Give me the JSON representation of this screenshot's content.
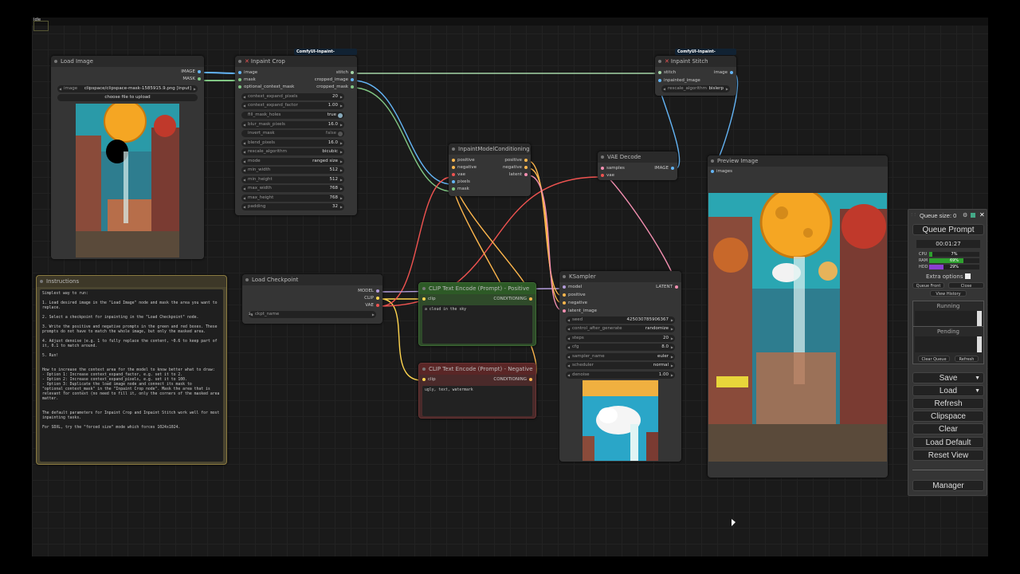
{
  "status": {
    "idle": "Idle"
  },
  "load_image": {
    "title": "Load Image",
    "outputs": [
      "IMAGE",
      "MASK"
    ],
    "image_label": "image",
    "image_value": "clipspace/clipspace-mask-1585915.9.png [input]",
    "upload_label": "choose file to upload"
  },
  "inpaint_crop": {
    "badge": "ComfyUI-Inpaint-CropAnd...",
    "title": "Inpaint Crop",
    "inputs": [
      "image",
      "mask",
      "optional_context_mask"
    ],
    "outputs": [
      "stitch",
      "cropped_image",
      "cropped_mask"
    ],
    "widgets": [
      {
        "label": "context_expand_pixels",
        "value": "20"
      },
      {
        "label": "context_expand_factor",
        "value": "1.00"
      },
      {
        "label": "fill_mask_holes",
        "value": "true"
      },
      {
        "label": "blur_mask_pixels",
        "value": "16.0"
      },
      {
        "label": "invert_mask",
        "value": "false"
      },
      {
        "label": "blend_pixels",
        "value": "16.0"
      },
      {
        "label": "rescale_algorithm",
        "value": "bicubic"
      },
      {
        "label": "mode",
        "value": "ranged size"
      },
      {
        "label": "min_width",
        "value": "512"
      },
      {
        "label": "min_height",
        "value": "512"
      },
      {
        "label": "max_width",
        "value": "768"
      },
      {
        "label": "max_height",
        "value": "768"
      },
      {
        "label": "padding",
        "value": "32"
      }
    ]
  },
  "inpaint_stitch": {
    "badge": "ComfyUI-Inpaint-CropAnd...",
    "title": "Inpaint Stitch",
    "inputs": [
      "stitch",
      "inpainted_image"
    ],
    "outputs": [
      "image"
    ],
    "widget_label": "rescale_algorithm",
    "widget_value": "bislerp"
  },
  "conditioning": {
    "title": "InpaintModelConditioning",
    "inputs": [
      "positive",
      "negative",
      "vae",
      "pixels",
      "mask"
    ],
    "outputs": [
      "positive",
      "negative",
      "latent"
    ]
  },
  "vae_decode": {
    "title": "VAE Decode",
    "inputs": [
      "samples",
      "vae"
    ],
    "outputs": [
      "IMAGE"
    ]
  },
  "preview": {
    "title": "Preview Image",
    "inputs": [
      "images"
    ]
  },
  "instructions": {
    "title": "Instructions",
    "text": "Simplest way to run:\n\n1. Load desired image in the \"Load Image\" node and mask the area you want to replace.\n\n2. Select a checkpoint for inpainting in the \"Load Checkpoint\" node.\n\n3. Write the positive and negative prompts in the green and red boxes. These prompts do not have to match the whole image, but only the masked area.\n\n4. Adjust denoise (e.g. 1 to fully replace the content, ~0.6 to keep part of it, 0.1 to match around.\n\n5. Run!\n\n\nHow to increase the context area for the model to know better what to draw:\n- Option 1: Increase context_expand_factor, e.g. set it to 2.\n- Option 2: Increase context_expand_pixels, e.g. set it to 100.\n- Option 3: Duplicate the load image node and connect its mask to \"optional_context_mask\" in the \"Inpaint Crop node\". Mask the area that is relevant for context (no need to fill it, only the corners of the masked area matter.\n\n\nThe default parameters for Inpaint Crop and Inpaint Stitch work well for most inpainting tasks.\n\nFor SDXL, try the \"forced size\" mode which forces 1024x1024."
  },
  "load_checkpoint": {
    "title": "Load Checkpoint",
    "outputs": [
      "MODEL",
      "CLIP",
      "VAE"
    ],
    "ckpt_label": "ckpt_name",
    "ckpt_value": "sd1.5-inpainting/realismixRealAmateur_v40Inpainting.safetensors"
  },
  "clip_positive": {
    "title": "CLIP Text Encode (Prompt) - Positive",
    "input": "clip",
    "output": "CONDITIONING",
    "text": "a cloud in the sky"
  },
  "clip_negative": {
    "title": "CLIP Text Encode (Prompt) - Negative",
    "input": "clip",
    "output": "CONDITIONING",
    "text": "ugly, text, watermark"
  },
  "ksampler": {
    "title": "KSampler",
    "inputs": [
      "model",
      "positive",
      "negative",
      "latent_image"
    ],
    "outputs": [
      "LATENT"
    ],
    "widgets": [
      {
        "label": "seed",
        "value": "425030785906367"
      },
      {
        "label": "control_after_generate",
        "value": "randomize"
      },
      {
        "label": "steps",
        "value": "20"
      },
      {
        "label": "cfg",
        "value": "8.0"
      },
      {
        "label": "sampler_name",
        "value": "euler"
      },
      {
        "label": "scheduler",
        "value": "normal"
      },
      {
        "label": "denoise",
        "value": "1.00"
      }
    ]
  },
  "queue": {
    "title": "Queue size: 0",
    "queue_prompt": "Queue Prompt",
    "timer": "00:01:27",
    "cpu_label": "CPU",
    "cpu": "7%",
    "cpu_frac": 0.07,
    "ram_label": "RAM",
    "ram": "69%",
    "ram_frac": 0.69,
    "hdd_label": "HDD",
    "hdd": "29%",
    "hdd_frac": 0.29,
    "extra_options": "Extra options",
    "queue_front": "Queue Front",
    "close": "Close",
    "view_history": "View History",
    "running": "Running",
    "pending": "Pending",
    "clear_queue": "Clear Queue",
    "refresh_small": "Refresh",
    "save": "Save",
    "load": "Load",
    "refresh": "Refresh",
    "clipspace": "Clipspace",
    "clear": "Clear",
    "load_default": "Load Default",
    "reset_view": "Reset View",
    "manager": "Manager",
    "colors": {
      "cpu": "#2ea02e",
      "ram": "#2ea02e",
      "hdd": "#8a3fd1"
    }
  }
}
